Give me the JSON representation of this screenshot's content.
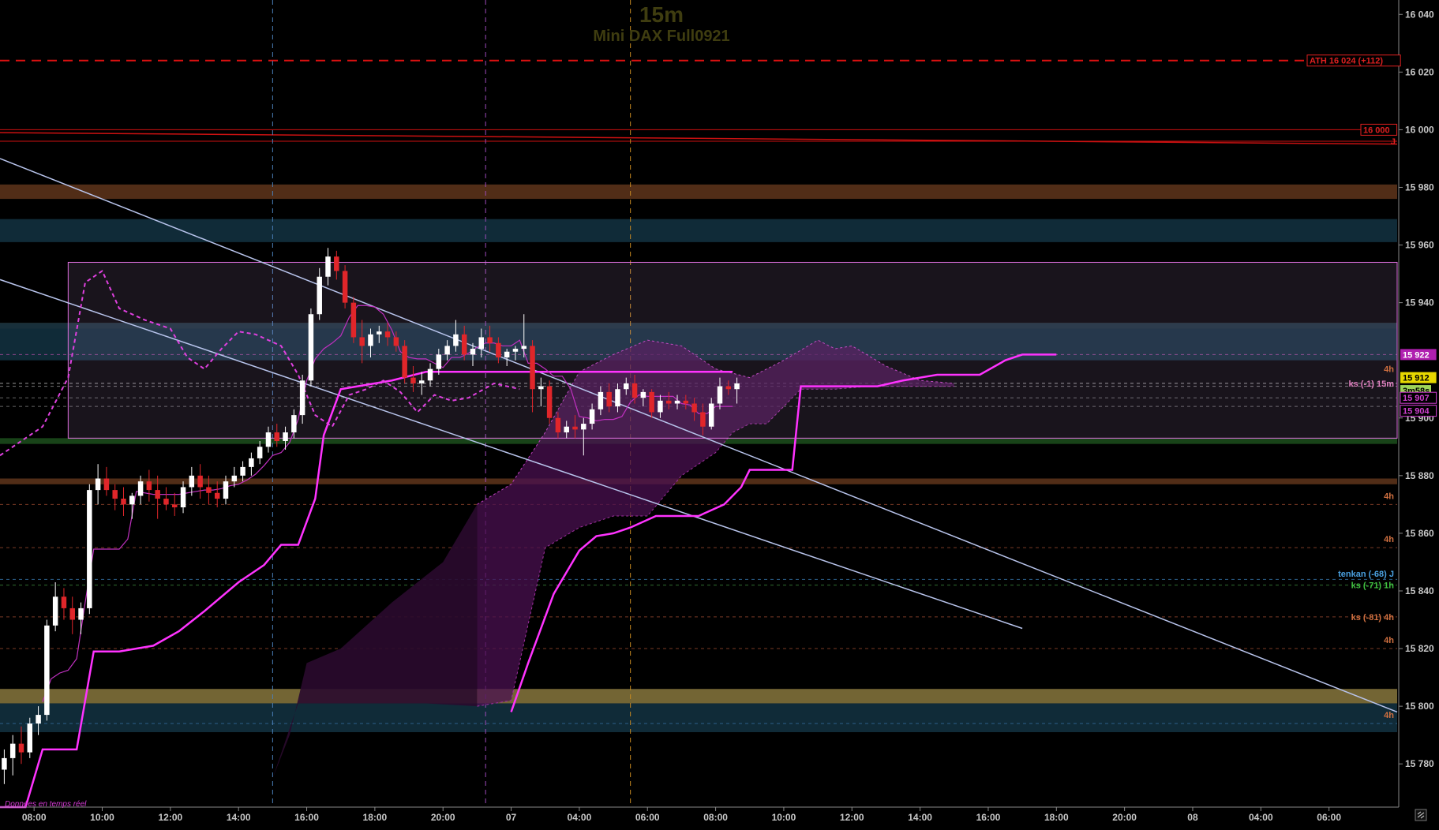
{
  "header": {
    "timeframe": "15m",
    "instrument": "Mini DAX Full0921"
  },
  "status": {
    "realtime_note": "Données en temps réel"
  },
  "price_axis": {
    "ticks": [
      "16 040",
      "16 020",
      "16 000",
      "15 980",
      "15 960",
      "15 940",
      "15 900",
      "15 880",
      "15 860",
      "15 840",
      "15 820",
      "15 800",
      "15 780"
    ]
  },
  "time_axis": {
    "ticks": [
      "08:00",
      "10:00",
      "12:00",
      "14:00",
      "16:00",
      "18:00",
      "20:00",
      "07",
      "04:00",
      "06:00",
      "08:00",
      "10:00",
      "12:00",
      "14:00",
      "16:00",
      "18:00",
      "20:00",
      "08",
      "04:00",
      "06:00"
    ]
  },
  "price_labels": {
    "ath": "ATH 16 024 (+112)",
    "level_16000": "16 000",
    "j_marker": "J",
    "cloud_top": "15 922",
    "current_price": "15 912",
    "countdown": "3m58s",
    "cloud_mid": "15 907",
    "cloud_bottom": "15 904",
    "ks_15m": "ks (-1) 15m",
    "h4_a": "4h",
    "h4_b": "4h",
    "h4_c": "4h",
    "tenkan_j": "tenkan (-68) J",
    "ks_1h": "ks (-71) 1h",
    "ks_4h": "ks (-81) 4h",
    "h4_d": "4h",
    "h4_e": "4h"
  },
  "colors": {
    "background": "#000000",
    "kijun": "#ff33ff",
    "ath_line": "#dd1111",
    "candle_up": "#ffffff",
    "candle_down": "#e0262a",
    "trendline": "#b8c4ec",
    "orange_zone": "#5a3219",
    "blue_zone": "#12303e",
    "gold_zone": "#80703a"
  },
  "chart_data": {
    "type": "candlestick",
    "timeframe": "15m",
    "ylim": [
      15765,
      16045
    ],
    "candles": [
      {
        "t": 0,
        "o": 15778,
        "h": 15785,
        "l": 15773,
        "c": 15782
      },
      {
        "t": 1,
        "o": 15782,
        "h": 15790,
        "l": 15776,
        "c": 15787
      },
      {
        "t": 2,
        "o": 15787,
        "h": 15793,
        "l": 15780,
        "c": 15784
      },
      {
        "t": 3,
        "o": 15784,
        "h": 15796,
        "l": 15782,
        "c": 15794
      },
      {
        "t": 4,
        "o": 15794,
        "h": 15800,
        "l": 15790,
        "c": 15797
      },
      {
        "t": 5,
        "o": 15797,
        "h": 15830,
        "l": 15795,
        "c": 15828
      },
      {
        "t": 6,
        "o": 15828,
        "h": 15843,
        "l": 15826,
        "c": 15838
      },
      {
        "t": 7,
        "o": 15838,
        "h": 15841,
        "l": 15830,
        "c": 15834
      },
      {
        "t": 8,
        "o": 15834,
        "h": 15838,
        "l": 15825,
        "c": 15830
      },
      {
        "t": 9,
        "o": 15830,
        "h": 15836,
        "l": 15825,
        "c": 15834
      },
      {
        "t": 10,
        "o": 15834,
        "h": 15877,
        "l": 15832,
        "c": 15875
      },
      {
        "t": 11,
        "o": 15875,
        "h": 15884,
        "l": 15870,
        "c": 15879
      },
      {
        "t": 12,
        "o": 15879,
        "h": 15883,
        "l": 15873,
        "c": 15875
      },
      {
        "t": 13,
        "o": 15875,
        "h": 15877,
        "l": 15868,
        "c": 15872
      },
      {
        "t": 14,
        "o": 15872,
        "h": 15876,
        "l": 15866,
        "c": 15870
      },
      {
        "t": 15,
        "o": 15870,
        "h": 15874,
        "l": 15865,
        "c": 15873
      },
      {
        "t": 16,
        "o": 15873,
        "h": 15880,
        "l": 15870,
        "c": 15878
      },
      {
        "t": 17,
        "o": 15878,
        "h": 15882,
        "l": 15871,
        "c": 15875
      },
      {
        "t": 18,
        "o": 15875,
        "h": 15880,
        "l": 15865,
        "c": 15872
      },
      {
        "t": 19,
        "o": 15872,
        "h": 15876,
        "l": 15868,
        "c": 15870
      },
      {
        "t": 20,
        "o": 15870,
        "h": 15874,
        "l": 15866,
        "c": 15869
      },
      {
        "t": 21,
        "o": 15869,
        "h": 15878,
        "l": 15867,
        "c": 15876
      },
      {
        "t": 22,
        "o": 15876,
        "h": 15883,
        "l": 15873,
        "c": 15880
      },
      {
        "t": 23,
        "o": 15880,
        "h": 15884,
        "l": 15872,
        "c": 15876
      },
      {
        "t": 24,
        "o": 15876,
        "h": 15880,
        "l": 15870,
        "c": 15874
      },
      {
        "t": 25,
        "o": 15874,
        "h": 15878,
        "l": 15869,
        "c": 15872
      },
      {
        "t": 26,
        "o": 15872,
        "h": 15880,
        "l": 15870,
        "c": 15878
      },
      {
        "t": 27,
        "o": 15878,
        "h": 15883,
        "l": 15876,
        "c": 15880
      },
      {
        "t": 28,
        "o": 15880,
        "h": 15885,
        "l": 15878,
        "c": 15883
      },
      {
        "t": 29,
        "o": 15883,
        "h": 15888,
        "l": 15880,
        "c": 15886
      },
      {
        "t": 30,
        "o": 15886,
        "h": 15892,
        "l": 15884,
        "c": 15890
      },
      {
        "t": 31,
        "o": 15890,
        "h": 15897,
        "l": 15888,
        "c": 15895
      },
      {
        "t": 32,
        "o": 15895,
        "h": 15898,
        "l": 15890,
        "c": 15892
      },
      {
        "t": 33,
        "o": 15892,
        "h": 15897,
        "l": 15889,
        "c": 15895
      },
      {
        "t": 34,
        "o": 15895,
        "h": 15903,
        "l": 15893,
        "c": 15901
      },
      {
        "t": 35,
        "o": 15901,
        "h": 15915,
        "l": 15898,
        "c": 15913
      },
      {
        "t": 36,
        "o": 15913,
        "h": 15938,
        "l": 15911,
        "c": 15936
      },
      {
        "t": 37,
        "o": 15936,
        "h": 15952,
        "l": 15934,
        "c": 15949
      },
      {
        "t": 38,
        "o": 15949,
        "h": 15959,
        "l": 15946,
        "c": 15956
      },
      {
        "t": 39,
        "o": 15956,
        "h": 15958,
        "l": 15948,
        "c": 15951
      },
      {
        "t": 40,
        "o": 15951,
        "h": 15953,
        "l": 15938,
        "c": 15940
      },
      {
        "t": 41,
        "o": 15940,
        "h": 15942,
        "l": 15926,
        "c": 15928
      },
      {
        "t": 42,
        "o": 15928,
        "h": 15934,
        "l": 15919,
        "c": 15925
      },
      {
        "t": 43,
        "o": 15925,
        "h": 15931,
        "l": 15921,
        "c": 15929
      },
      {
        "t": 44,
        "o": 15929,
        "h": 15932,
        "l": 15926,
        "c": 15930
      },
      {
        "t": 45,
        "o": 15930,
        "h": 15933,
        "l": 15925,
        "c": 15928
      },
      {
        "t": 46,
        "o": 15928,
        "h": 15930,
        "l": 15923,
        "c": 15925
      },
      {
        "t": 47,
        "o": 15925,
        "h": 15927,
        "l": 15912,
        "c": 15914
      },
      {
        "t": 48,
        "o": 15914,
        "h": 15918,
        "l": 15909,
        "c": 15912
      },
      {
        "t": 49,
        "o": 15912,
        "h": 15916,
        "l": 15908,
        "c": 15913
      },
      {
        "t": 50,
        "o": 15913,
        "h": 15919,
        "l": 15911,
        "c": 15917
      },
      {
        "t": 51,
        "o": 15917,
        "h": 15924,
        "l": 15915,
        "c": 15922
      },
      {
        "t": 52,
        "o": 15922,
        "h": 15927,
        "l": 15920,
        "c": 15925
      },
      {
        "t": 53,
        "o": 15925,
        "h": 15934,
        "l": 15923,
        "c": 15929
      },
      {
        "t": 54,
        "o": 15929,
        "h": 15932,
        "l": 15920,
        "c": 15922
      },
      {
        "t": 55,
        "o": 15922,
        "h": 15926,
        "l": 15918,
        "c": 15924
      },
      {
        "t": 56,
        "o": 15924,
        "h": 15931,
        "l": 15921,
        "c": 15928
      },
      {
        "t": 57,
        "o": 15928,
        "h": 15932,
        "l": 15923,
        "c": 15926
      },
      {
        "t": 58,
        "o": 15926,
        "h": 15928,
        "l": 15919,
        "c": 15921
      },
      {
        "t": 59,
        "o": 15921,
        "h": 15924,
        "l": 15918,
        "c": 15923
      },
      {
        "t": 60,
        "o": 15923,
        "h": 15925,
        "l": 15920,
        "c": 15924
      },
      {
        "t": 61,
        "o": 15924,
        "h": 15936,
        "l": 15921,
        "c": 15925
      },
      {
        "t": 62,
        "o": 15925,
        "h": 15927,
        "l": 15902,
        "c": 15910
      },
      {
        "t": 63,
        "o": 15910,
        "h": 15914,
        "l": 15904,
        "c": 15911
      },
      {
        "t": 64,
        "o": 15911,
        "h": 15913,
        "l": 15898,
        "c": 15900
      },
      {
        "t": 65,
        "o": 15900,
        "h": 15902,
        "l": 15893,
        "c": 15895
      },
      {
        "t": 66,
        "o": 15895,
        "h": 15899,
        "l": 15893,
        "c": 15897
      },
      {
        "t": 67,
        "o": 15897,
        "h": 15901,
        "l": 15893,
        "c": 15896
      },
      {
        "t": 68,
        "o": 15896,
        "h": 15900,
        "l": 15887,
        "c": 15898
      },
      {
        "t": 69,
        "o": 15898,
        "h": 15905,
        "l": 15896,
        "c": 15903
      },
      {
        "t": 70,
        "o": 15903,
        "h": 15911,
        "l": 15901,
        "c": 15909
      },
      {
        "t": 71,
        "o": 15909,
        "h": 15912,
        "l": 15902,
        "c": 15904
      },
      {
        "t": 72,
        "o": 15904,
        "h": 15912,
        "l": 15902,
        "c": 15910
      },
      {
        "t": 73,
        "o": 15910,
        "h": 15914,
        "l": 15908,
        "c": 15912
      },
      {
        "t": 74,
        "o": 15912,
        "h": 15915,
        "l": 15905,
        "c": 15907
      },
      {
        "t": 75,
        "o": 15907,
        "h": 15910,
        "l": 15904,
        "c": 15909
      },
      {
        "t": 76,
        "o": 15909,
        "h": 15910,
        "l": 15900,
        "c": 15902
      },
      {
        "t": 77,
        "o": 15902,
        "h": 15908,
        "l": 15900,
        "c": 15906
      },
      {
        "t": 78,
        "o": 15906,
        "h": 15909,
        "l": 15903,
        "c": 15905
      },
      {
        "t": 79,
        "o": 15905,
        "h": 15908,
        "l": 15903,
        "c": 15906
      },
      {
        "t": 80,
        "o": 15906,
        "h": 15908,
        "l": 15903,
        "c": 15905
      },
      {
        "t": 81,
        "o": 15905,
        "h": 15907,
        "l": 15899,
        "c": 15902
      },
      {
        "t": 82,
        "o": 15902,
        "h": 15905,
        "l": 15894,
        "c": 15897
      },
      {
        "t": 83,
        "o": 15897,
        "h": 15907,
        "l": 15896,
        "c": 15905
      },
      {
        "t": 84,
        "o": 15905,
        "h": 15914,
        "l": 15903,
        "c": 15911
      },
      {
        "t": 85,
        "o": 15911,
        "h": 15913,
        "l": 15908,
        "c": 15910
      },
      {
        "t": 86,
        "o": 15910,
        "h": 15914,
        "l": 15905,
        "c": 15912
      }
    ],
    "kijun": [
      [
        0,
        15765
      ],
      [
        3,
        15765
      ],
      [
        5,
        15785
      ],
      [
        9,
        15785
      ],
      [
        11,
        15819
      ],
      [
        14,
        15819
      ],
      [
        18,
        15821
      ],
      [
        21,
        15826
      ],
      [
        24,
        15833
      ],
      [
        28,
        15843
      ],
      [
        31,
        15849
      ],
      [
        33,
        15856
      ],
      [
        35,
        15856
      ],
      [
        37,
        15872
      ],
      [
        38,
        15894
      ],
      [
        40,
        15910
      ],
      [
        46,
        15913
      ],
      [
        50,
        15916
      ],
      [
        53,
        15916
      ],
      [
        56,
        15916
      ],
      [
        61,
        15916
      ],
      [
        64,
        15916
      ],
      [
        68,
        15916
      ],
      [
        72,
        15916
      ],
      [
        76,
        15916
      ],
      [
        80,
        15916
      ],
      [
        84,
        15916
      ],
      [
        86,
        15916
      ]
    ],
    "kijun_projection": [
      [
        60,
        15798
      ],
      [
        62,
        15815
      ],
      [
        65,
        15839
      ],
      [
        68,
        15854
      ],
      [
        70,
        15859
      ],
      [
        72,
        15860
      ],
      [
        74,
        15862
      ],
      [
        77,
        15866
      ],
      [
        82,
        15866
      ],
      [
        85,
        15870
      ],
      [
        87,
        15876
      ],
      [
        88,
        15882
      ],
      [
        93,
        15882
      ],
      [
        94,
        15911
      ],
      [
        100,
        15911
      ],
      [
        103,
        15911
      ],
      [
        106,
        15913
      ],
      [
        110,
        15915
      ],
      [
        112,
        15915
      ],
      [
        115,
        15915
      ],
      [
        118,
        15920
      ],
      [
        120,
        15922
      ],
      [
        124,
        15922
      ]
    ],
    "chikou": [
      [
        0,
        15887
      ],
      [
        3,
        15893
      ],
      [
        5,
        15897
      ],
      [
        8,
        15914
      ],
      [
        10,
        15947
      ],
      [
        12,
        15951
      ],
      [
        14,
        15938
      ],
      [
        17,
        15934
      ],
      [
        20,
        15931
      ],
      [
        22,
        15921
      ],
      [
        24,
        15917
      ],
      [
        26,
        15924
      ],
      [
        28,
        15930
      ],
      [
        30,
        15929
      ],
      [
        33,
        15925
      ],
      [
        35,
        15915
      ],
      [
        37,
        15901
      ],
      [
        39,
        15897
      ],
      [
        41,
        15908
      ],
      [
        43,
        15910
      ],
      [
        45,
        15913
      ],
      [
        47,
        15909
      ],
      [
        49,
        15902
      ],
      [
        51,
        15908
      ],
      [
        53,
        15906
      ],
      [
        55,
        15907
      ],
      [
        58,
        15912
      ],
      [
        61,
        15910
      ]
    ],
    "cloud_spans": {
      "upper": [
        [
          56,
          15870
        ],
        [
          60,
          15877
        ],
        [
          64,
          15895
        ],
        [
          68,
          15916
        ],
        [
          72,
          15922
        ],
        [
          76,
          15927
        ],
        [
          80,
          15925
        ],
        [
          84,
          15917
        ],
        [
          88,
          15914
        ],
        [
          92,
          15920
        ],
        [
          96,
          15927
        ],
        [
          98,
          15924
        ],
        [
          100,
          15925
        ],
        [
          104,
          15918
        ],
        [
          108,
          15913
        ],
        [
          112,
          15912
        ]
      ],
      "lower": [
        [
          56,
          15800
        ],
        [
          60,
          15802
        ],
        [
          64,
          15855
        ],
        [
          68,
          15862
        ],
        [
          72,
          15866
        ],
        [
          76,
          15866
        ],
        [
          80,
          15880
        ],
        [
          84,
          15888
        ],
        [
          86,
          15895
        ],
        [
          88,
          15898
        ],
        [
          90,
          15898
        ],
        [
          94,
          15910
        ],
        [
          98,
          15910
        ],
        [
          102,
          15911
        ],
        [
          106,
          15911
        ],
        [
          110,
          15911
        ],
        [
          112,
          15911
        ]
      ]
    },
    "horizontal_levels": [
      {
        "name": "ATH",
        "price": 16024
      },
      {
        "name": "round",
        "price": 16000
      },
      {
        "name": "J",
        "price": 15996
      },
      {
        "name": "cloud_top",
        "price": 15922
      },
      {
        "name": "current",
        "price": 15912
      },
      {
        "name": "ks 15m",
        "price": 15911
      },
      {
        "name": "cloud_mid",
        "price": 15907
      },
      {
        "name": "cloud_bottom",
        "price": 15904
      },
      {
        "name": "4h_a",
        "price": 15870
      },
      {
        "name": "4h_b",
        "price": 15855
      },
      {
        "name": "tenkan J",
        "price": 15844
      },
      {
        "name": "ks 1h",
        "price": 15842
      },
      {
        "name": "ks 4h",
        "price": 15831
      },
      {
        "name": "4h_c",
        "price": 15820
      },
      {
        "name": "4h_d",
        "price": 15794
      }
    ],
    "zones": [
      {
        "color": "orange",
        "from": 15976,
        "to": 15981
      },
      {
        "color": "blue",
        "from": 15961,
        "to": 15969
      },
      {
        "color": "orange",
        "from": 15931,
        "to": 15933
      },
      {
        "color": "blue",
        "from": 15920,
        "to": 15933
      },
      {
        "color": "green",
        "from": 15891,
        "to": 15893
      },
      {
        "color": "orange",
        "from": 15877,
        "to": 15879
      },
      {
        "color": "gold",
        "from": 15801,
        "to": 15806
      },
      {
        "color": "blue",
        "from": 15791,
        "to": 15801
      }
    ],
    "range_box": {
      "t_start": 8,
      "t_end": 164,
      "price_top": 15954,
      "price_bottom": 15893
    },
    "trendlines": [
      {
        "p1": {
          "t": 0,
          "price": 15990
        },
        "p2": {
          "t": 164,
          "price": 15798
        }
      },
      {
        "p1": {
          "t": 0,
          "price": 15948
        },
        "p2": {
          "t": 120,
          "price": 15827
        }
      }
    ],
    "session_markers": [
      {
        "t": 32,
        "color": "blue"
      },
      {
        "t": 57,
        "color": "purple"
      },
      {
        "t": 74,
        "color": "orange"
      }
    ]
  }
}
